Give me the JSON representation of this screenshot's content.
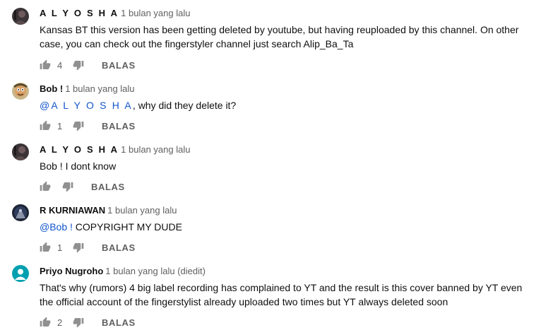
{
  "comments": [
    {
      "author": "A L Y O S H A",
      "time": "1 bulan yang lalu",
      "text": "Kansas BT this version has been getting deleted by youtube, but having reuploaded by this channel. On other case, you can check out the fingerstyler channel just search Alip_Ba_Ta",
      "likes": "4",
      "reply_label": "BALAS",
      "avatar_icon": "user-avatar-dark"
    },
    {
      "author": "Bob !",
      "time": "1 bulan yang lalu",
      "mention": "@A L Y O S H A",
      "text": ", why did they delete it?",
      "likes": "1",
      "reply_label": "BALAS",
      "avatar_icon": "user-avatar-cartoon"
    },
    {
      "author": "A L Y O S H A",
      "time": "1 bulan yang lalu",
      "text": "Bob ! I dont know",
      "likes": "",
      "reply_label": "BALAS",
      "avatar_icon": "user-avatar-dark"
    },
    {
      "author": "R KURNIAWAN",
      "time": "1 bulan yang lalu",
      "mention": "@Bob !",
      "text": " COPYRIGHT MY DUDE",
      "likes": "1",
      "reply_label": "BALAS",
      "avatar_icon": "user-avatar-night"
    },
    {
      "author": "Priyo Nugroho",
      "time": "1 bulan yang lalu (diedit)",
      "text": "That's why (rumors) 4 big label recording has complained to YT and the result is this cover banned by YT even the official account of the fingerstylist already uploaded two times but YT always deleted soon",
      "likes": "2",
      "reply_label": "BALAS",
      "avatar_icon": "user-avatar-default"
    }
  ],
  "colors": {
    "text": "#0f0f0f",
    "secondary": "#606060",
    "mention": "#1155cc",
    "default_avatar": "#00a0b0"
  }
}
